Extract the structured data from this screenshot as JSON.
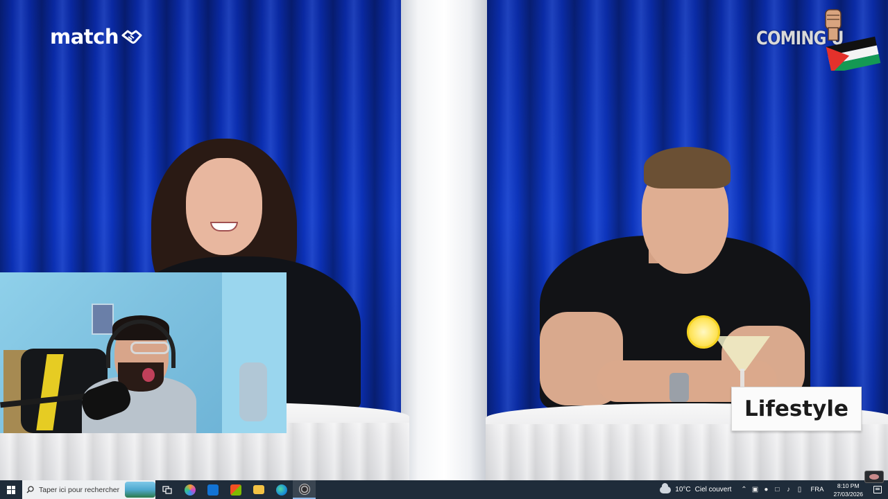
{
  "video": {
    "brand_logo_text": "match",
    "overlay_banner": "COMING U",
    "name_card": "Lifestyle"
  },
  "taskbar": {
    "search_placeholder": "Taper ici pour rechercher",
    "apps": [
      "task-view-icon",
      "copilot-icon",
      "outlook-icon",
      "store-icon",
      "file-explorer-icon",
      "edge-icon",
      "obs-icon"
    ],
    "weather": {
      "temperature": "10°C",
      "condition": "Ciel couvert"
    },
    "language": "FRA",
    "time": "8:10 PM",
    "date": "27/03/2026"
  },
  "colors": {
    "curtain": "#0d35c4",
    "taskbar": "#1f2c3a",
    "facecam_wall": "#8fd0ea"
  }
}
